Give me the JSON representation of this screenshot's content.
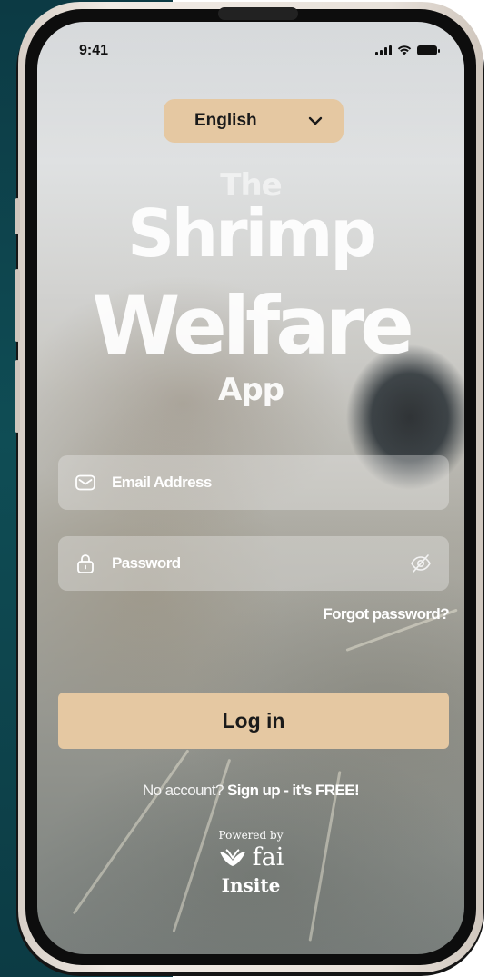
{
  "status_bar": {
    "time": "9:41"
  },
  "language": {
    "selected": "English"
  },
  "title": {
    "line1": "The",
    "line2": "Shrimp",
    "line3": "Welfare",
    "line4": "App"
  },
  "form": {
    "email_placeholder": "Email Address",
    "password_placeholder": "Password",
    "forgot_password": "Forgot password?",
    "login_label": "Log in"
  },
  "signup": {
    "prompt": "No account?",
    "link": "Sign up - it's FREE!"
  },
  "footer": {
    "powered_by": "Powered by",
    "brand": "fai",
    "brand_sub": "Insite"
  },
  "colors": {
    "accent": "#e5c8a2",
    "background_left": "#0f4d55"
  }
}
